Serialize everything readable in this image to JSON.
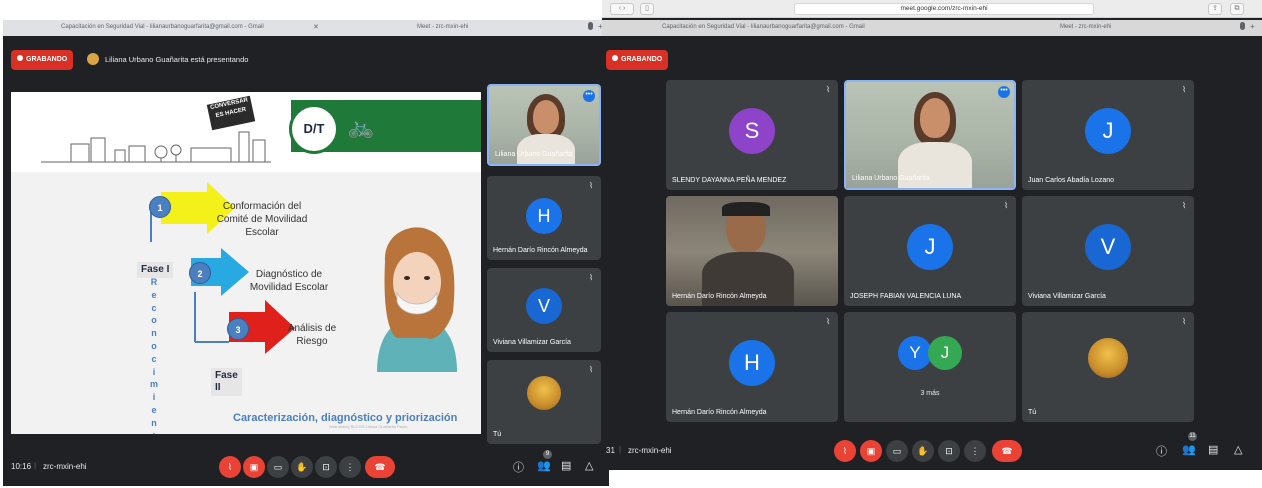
{
  "left": {
    "tabs": [
      {
        "title": "Capacitación en Seguridad Vial - lilianaurbanoguarfarita@gmail.com - Gmail"
      },
      {
        "title": "Meet - zrc-mxin-ehi"
      }
    ],
    "recording_label": "GRABANDO",
    "presenting_text": "Liliana Urbano Guañarita está presentando",
    "slide": {
      "logo_text": "D/T",
      "stamp_text": "CONVERSAR ES HACER",
      "step1": "Conformación del\nComité de Movilidad\nEscolar",
      "step2": "Diagnóstico de\nMovilidad Escolar",
      "step3": "Análisis de\nRiesgo",
      "num1": "1",
      "num2": "2",
      "num3": "3",
      "fase1": "Fase I",
      "fase2": "Fase\nII",
      "vertical_word": "R\ne\nc\no\nn\no\nc\ni\nm\ni\ne\nn\nt\no",
      "footer": "Caracterización, diagnóstico y priorización",
      "credit": "Web sliding BLOGS Liliana Guañarita Pardo"
    },
    "participants": [
      {
        "name": "Liliana Urbano Guañarita",
        "initial": "",
        "color": ""
      },
      {
        "name": "Hernán Darío Rincón Almeyda",
        "initial": "H",
        "color": "#1a73e8"
      },
      {
        "name": "Viviana Villamizar García",
        "initial": "V",
        "color": "#1967d2"
      },
      {
        "name": "Tú",
        "initial": "",
        "color": ""
      }
    ],
    "time": "10:16",
    "meeting_code": "zrc-mxin-ehi",
    "people_count": "9"
  },
  "right": {
    "url": "meet.google.com/zrc-mxin-ehi",
    "tabs": [
      {
        "title": "Capacitación en Seguridad Vial - lilianaurbanoguarfarita@gmail.com - Gmail"
      },
      {
        "title": "Meet - zrc-mxin-ehi"
      }
    ],
    "recording_label": "GRABANDO",
    "tiles": [
      {
        "name": "SLENDY DAYANNA PEÑA MENDEZ",
        "initial": "S",
        "color": "#8e44c9"
      },
      {
        "name": "Liliana Urbano Guañarita",
        "initial": "",
        "color": ""
      },
      {
        "name": "Juan Carlos Abadía Lozano",
        "initial": "J",
        "color": "#1a73e8"
      },
      {
        "name": "Hernán Darío Rincón Almeyda",
        "initial": "",
        "color": ""
      },
      {
        "name": "JOSEPH FABIAN VALENCIA LUNA",
        "initial": "J",
        "color": "#1a73e8"
      },
      {
        "name": "Viviana Villamizar García",
        "initial": "V",
        "color": "#1967d2"
      },
      {
        "name": "Hernán Darío Rincón Almeyda",
        "initial": "H",
        "color": "#1a73e8"
      },
      {
        "name": "3 más",
        "initial": "",
        "color": ""
      },
      {
        "name": "Tú",
        "initial": "",
        "color": ""
      }
    ],
    "more_initials": [
      "Y",
      "J"
    ],
    "time_partial": "31",
    "meeting_code": "zrc-mxin-ehi",
    "people_count": "11"
  },
  "colors": {
    "meet_bg": "#202124",
    "tile_bg": "#3c4043",
    "record_red": "#d93025",
    "hangup_red": "#ea4335"
  },
  "icons": {
    "mic_off": "mic-off-icon",
    "cam_off": "camera-off-icon",
    "captions": "captions-icon",
    "hand": "raise-hand-icon",
    "present": "present-icon",
    "more": "more-vert-icon",
    "hangup": "hangup-icon",
    "info": "info-icon",
    "people": "people-icon",
    "chat": "chat-icon",
    "activities": "activities-icon"
  }
}
